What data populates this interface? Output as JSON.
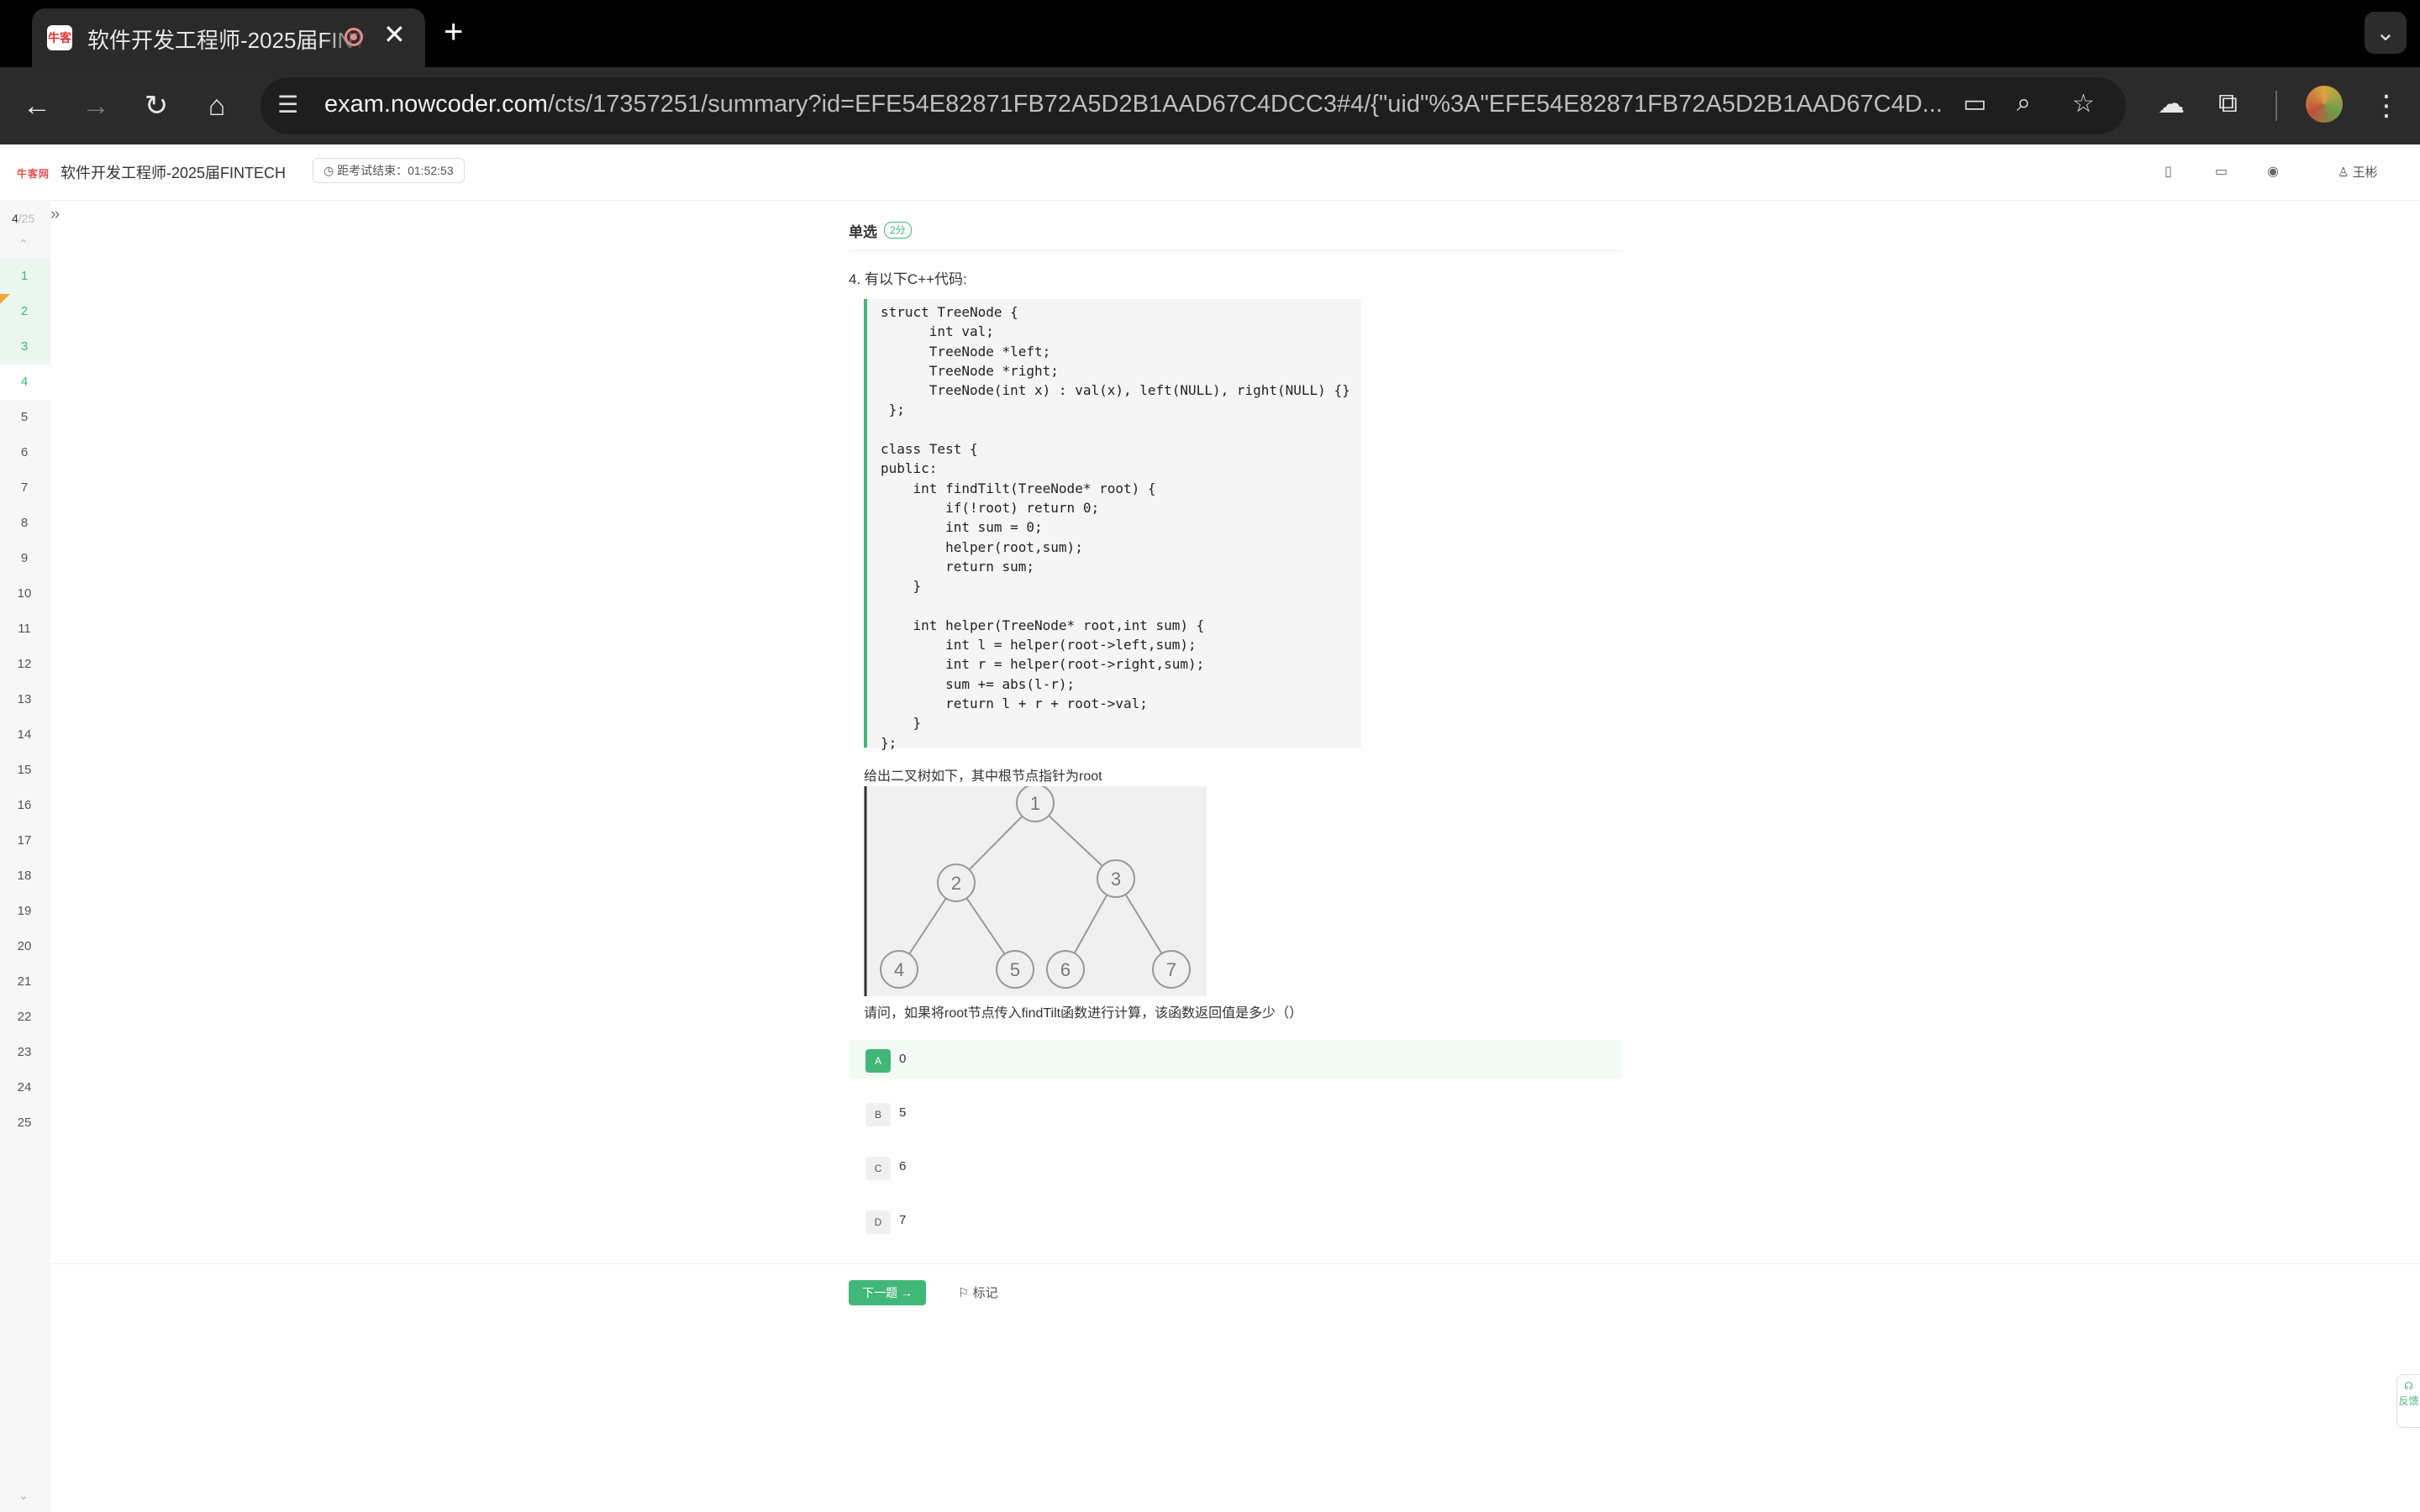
{
  "browser": {
    "tab_title": "软件开发工程师-2025届FINTECH",
    "favicon_text": "牛客",
    "url_host": "exam.nowcoder.com",
    "url_path": "/cts/17357251/summary?id=EFE54E82871FB72A5D2B1AAD67C4DCC3#4/{\"uid\"%3A\"EFE54E82871FB72A5D2B1AAD67C4D..."
  },
  "header": {
    "exam_name": "软件开发工程师-2025届FINTECH",
    "timer_label": "距考试结束：",
    "timer_value": "01:52:53",
    "user_name": "王彬",
    "logo_text": "牛客网"
  },
  "navigator": {
    "current": "4",
    "total": "/25",
    "questions": [
      "1",
      "2",
      "3",
      "4",
      "5",
      "6",
      "7",
      "8",
      "9",
      "10",
      "11",
      "12",
      "13",
      "14",
      "15",
      "16",
      "17",
      "18",
      "19",
      "20",
      "21",
      "22",
      "23",
      "24",
      "25"
    ],
    "answered": [
      "1",
      "2",
      "3"
    ],
    "flagged": [
      "2"
    ],
    "current_index": 3
  },
  "question": {
    "type": "单选",
    "score": "2分",
    "number": "4.",
    "title": "有以下C++代码:",
    "code": "struct TreeNode {\n      int val;\n      TreeNode *left;\n      TreeNode *right;\n      TreeNode(int x) : val(x), left(NULL), right(NULL) {}\n };\n\nclass Test {\npublic:\n    int findTilt(TreeNode* root) {\n        if(!root) return 0;\n        int sum = 0;\n        helper(root,sum);\n        return sum;\n    }\n\n    int helper(TreeNode* root,int sum) {\n        int l = helper(root->left,sum);\n        int r = helper(root->right,sum);\n        sum += abs(l-r);\n        return l + r + root->val;\n    }\n};",
    "figure_caption": "给出二叉树如下，其中根节点指针为root",
    "tree_nodes": [
      "1",
      "2",
      "3",
      "4",
      "5",
      "6",
      "7"
    ],
    "prompt": "请问，如果将root节点传入findTilt函数进行计算，该函数返回值是多少（）",
    "options": [
      {
        "letter": "A",
        "value": "0",
        "selected": true
      },
      {
        "letter": "B",
        "value": "5",
        "selected": false
      },
      {
        "letter": "C",
        "value": "6",
        "selected": false
      },
      {
        "letter": "D",
        "value": "7",
        "selected": false
      }
    ]
  },
  "footer": {
    "next_label": "下一题 →",
    "mark_label": "标记",
    "feedback_label": "反馈"
  },
  "colors": {
    "accent": "#42b77a",
    "flag": "#f2a33a",
    "chrome_dark": "#2b2b2b"
  }
}
